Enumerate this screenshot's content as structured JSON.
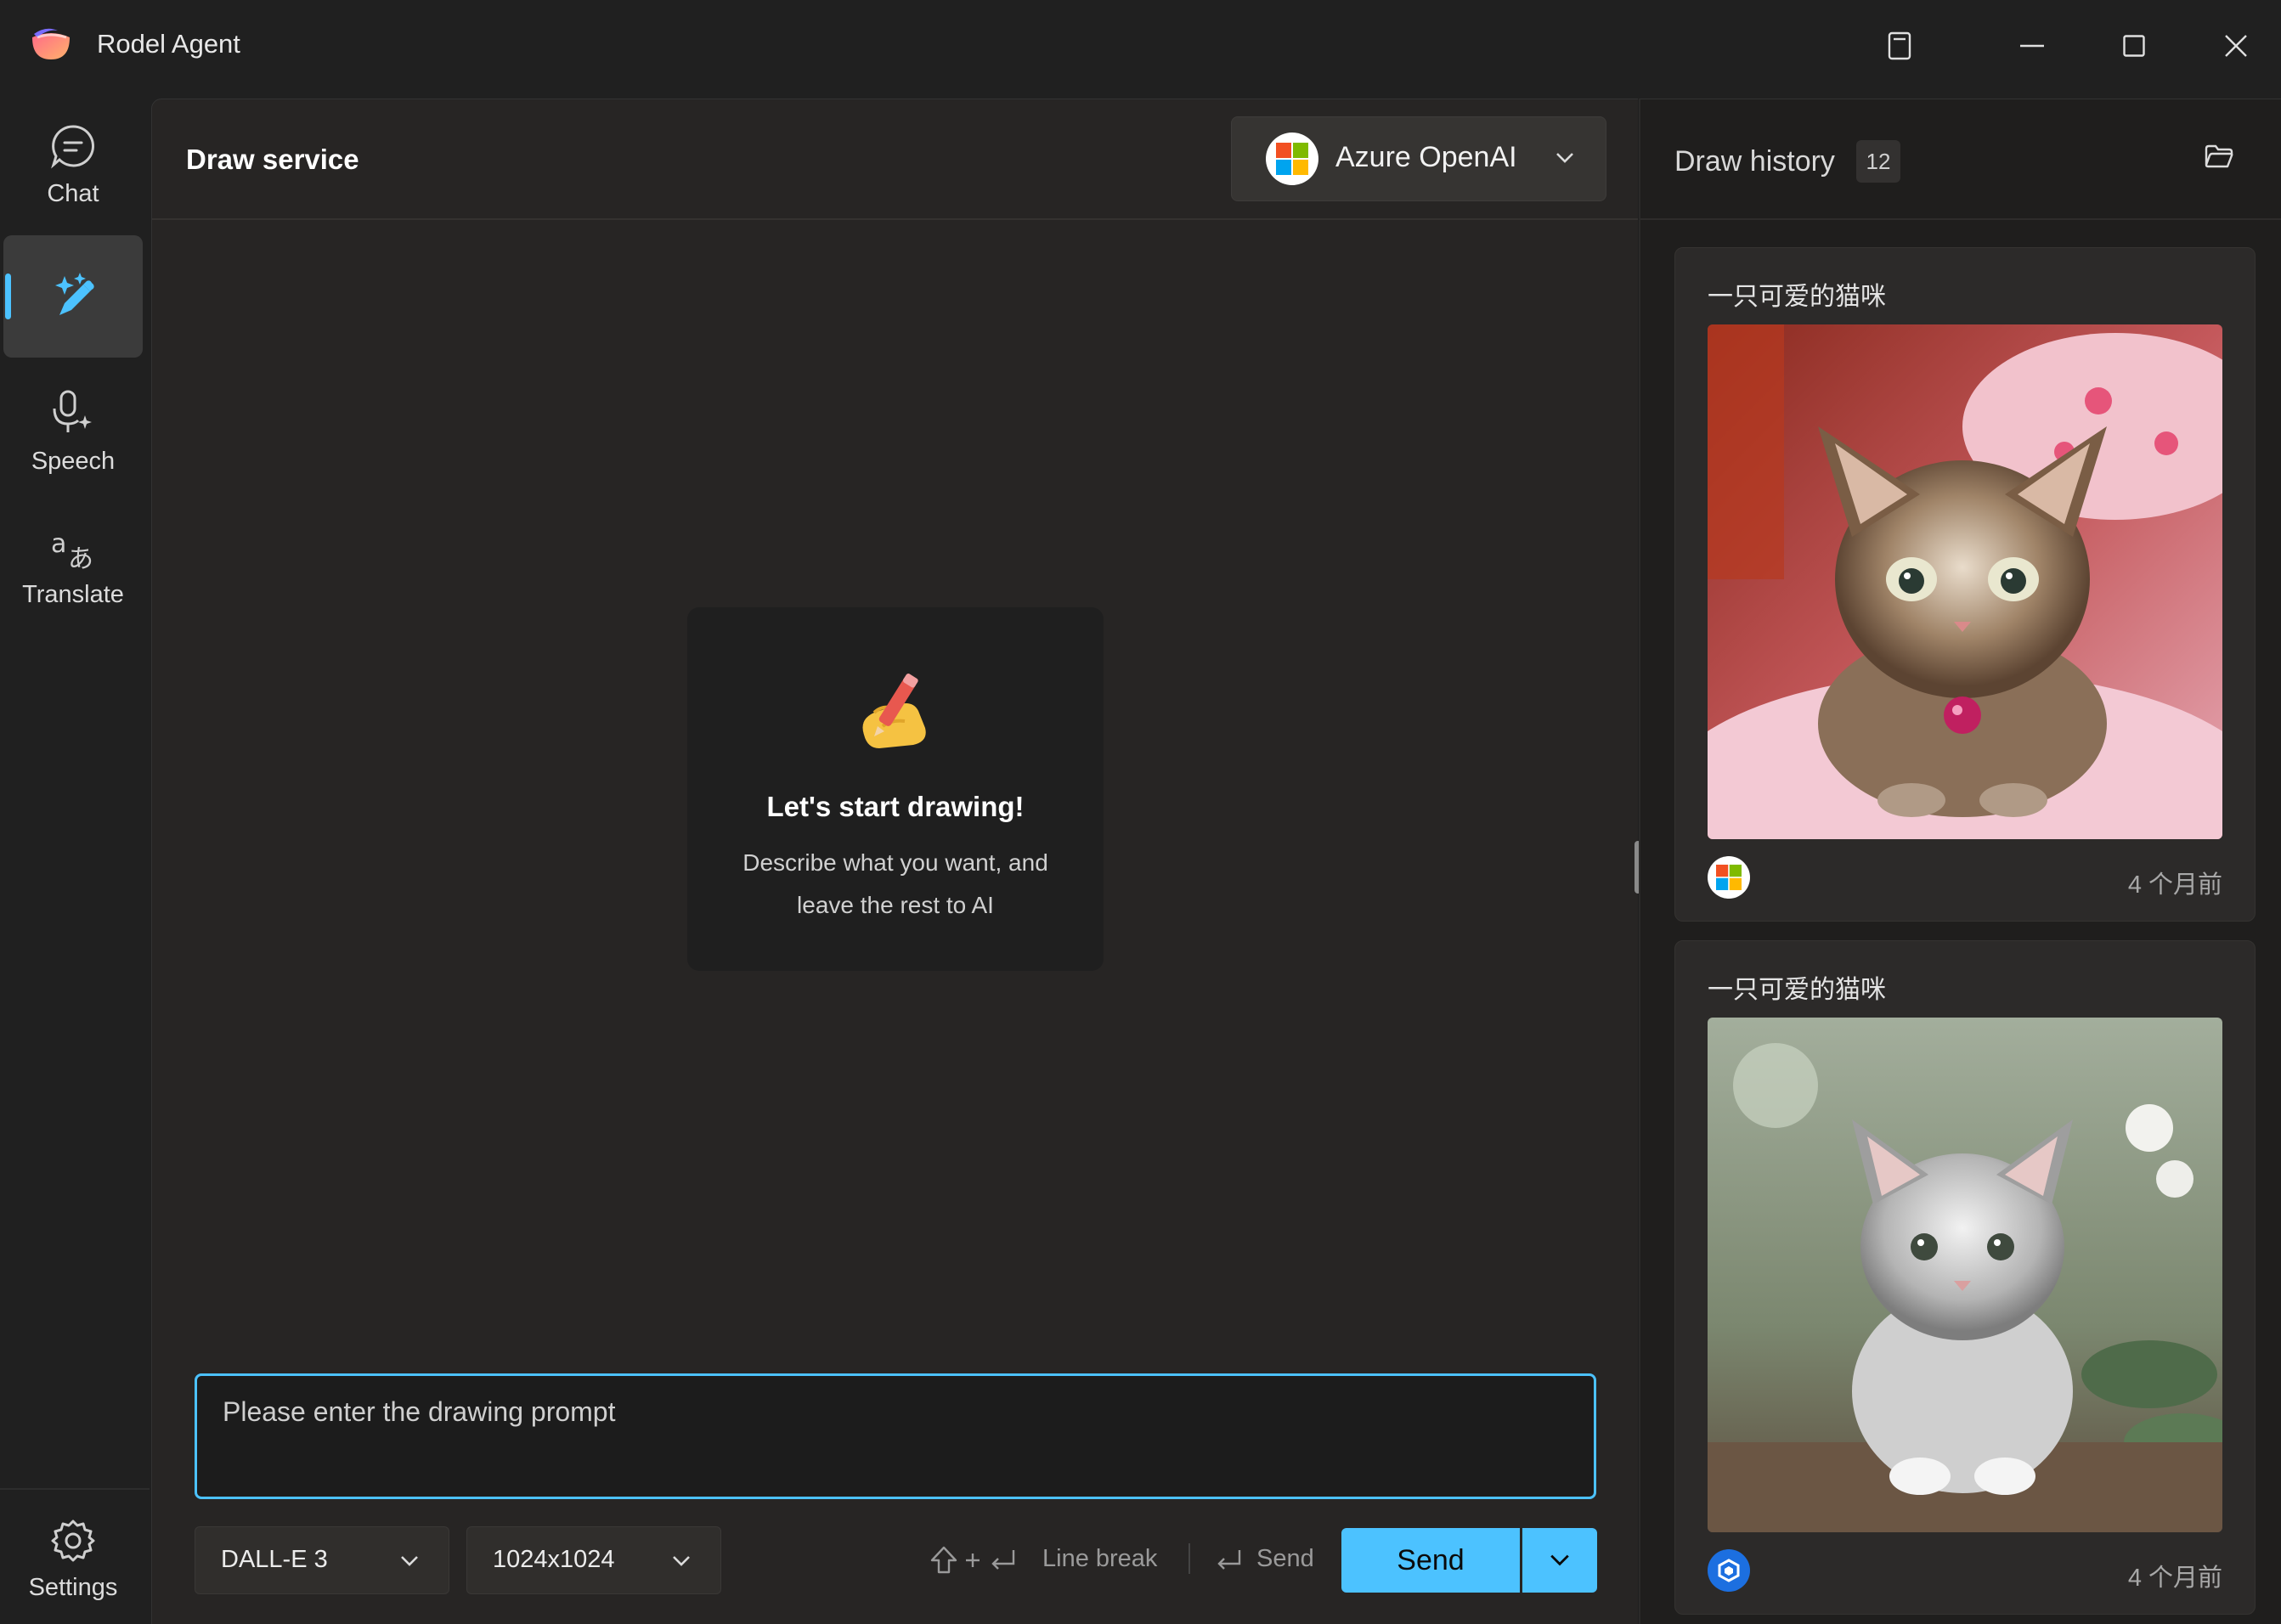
{
  "app": {
    "title": "Rodel Agent"
  },
  "nav": {
    "items": [
      {
        "label": "Chat",
        "icon": "chat-bubble-icon"
      },
      {
        "label": "",
        "icon": "draw-sparkle-icon",
        "active": true
      },
      {
        "label": "Speech",
        "icon": "microphone-sparkle-icon"
      },
      {
        "label": "Translate",
        "icon": "translate-icon"
      }
    ],
    "settings_label": "Settings"
  },
  "main": {
    "title": "Draw service",
    "provider": {
      "label": "Azure OpenAI",
      "icon": "microsoft-logo-icon"
    },
    "empty": {
      "title": "Let's start drawing!",
      "description": "Describe what you want, and leave the rest to AI"
    },
    "prompt_placeholder": "Please enter the drawing prompt",
    "model_select": "DALL-E 3",
    "size_select": "1024x1024",
    "hint_line_break": "Line break",
    "hint_send": "Send",
    "send_label": "Send"
  },
  "history": {
    "title": "Draw history",
    "count": "12",
    "items": [
      {
        "prompt": "一只可爱的猫咪",
        "time": "4 个月前",
        "provider_icon": "microsoft-logo-icon"
      },
      {
        "prompt": "一只可爱的猫咪",
        "time": "4 个月前",
        "provider_icon": "ai-provider-logo-icon"
      }
    ]
  },
  "colors": {
    "accent": "#4cc2ff",
    "background": "#202020",
    "panel": "#272524"
  }
}
